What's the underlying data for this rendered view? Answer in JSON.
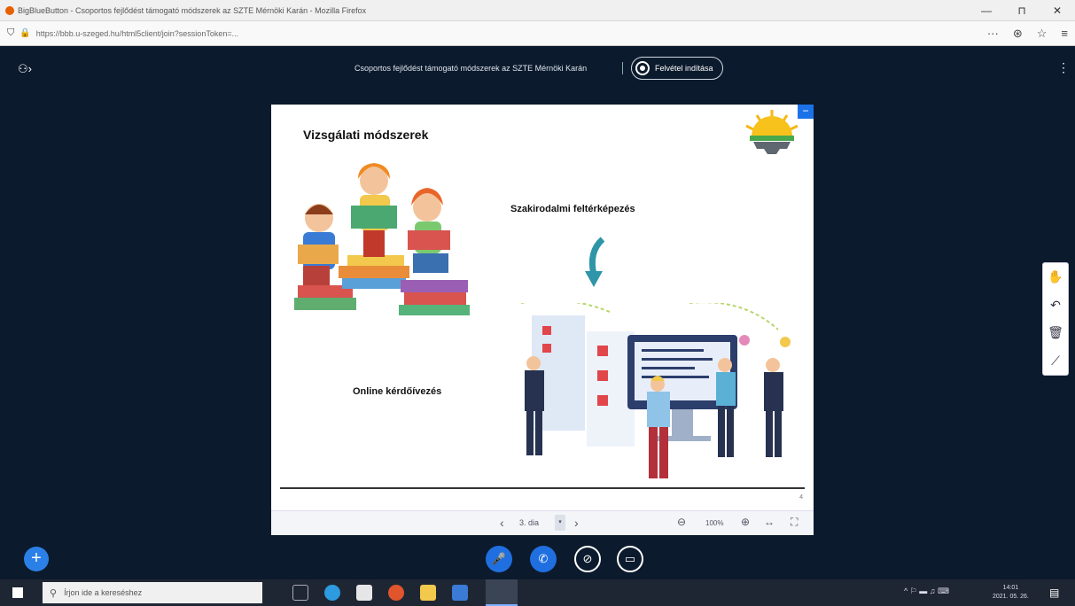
{
  "browser": {
    "window_title": "BigBlueButton - Csoportos fejlődést támogató módszerek az SZTE Mérnöki Karán - Mozilla Firefox",
    "url": "https://bbb.u-szeged.hu/html5client/join?sessionToken=...",
    "min": "—",
    "max": "⊓",
    "close": "✕"
  },
  "meeting": {
    "title": "Csoportos fejlődést támogató módszerek az SZTE Mérnöki Karán",
    "record_label": "Felvétel indítása"
  },
  "slide": {
    "title": "Vizsgálati módszerek",
    "literature_label": "Szakirodalmi feltérképezés",
    "online_label": "Online kérdőívezés",
    "minimize": "−",
    "page_number": "4"
  },
  "slide_controls": {
    "page": "3. dia",
    "zoom": "100%"
  },
  "taskbar": {
    "search_placeholder": "Írjon ide a kereséshez",
    "tray_text": "^ ⚐ ▬ ♫ ⌨",
    "time": "14:01",
    "date": "2021. 05. 26."
  },
  "colors": {
    "background": "#0b1a2c",
    "accent": "#1b72e8"
  }
}
